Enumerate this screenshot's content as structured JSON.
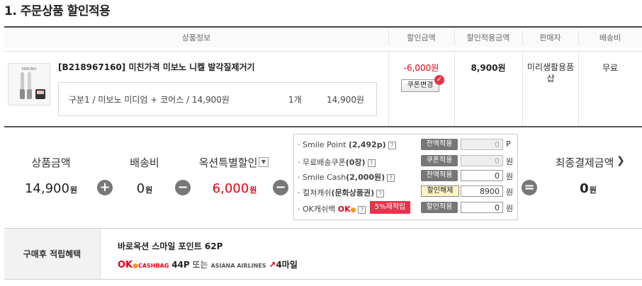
{
  "page_title": "1. 주문상품 할인적용",
  "headers": {
    "product_info": "상품정보",
    "discount_amount": "할인금액",
    "discounted_price": "할인적용금액",
    "seller": "판매자",
    "shipping_fee": "배송비"
  },
  "product": {
    "name": "[B218967160] 미친가격 미보노 니켈 발각질제거기",
    "option_text": "구분1 / 미보노 미디엄 + 코어스 / 14,900원",
    "quantity": "1개",
    "option_price": "14,900원",
    "thumb_brand": "MIBONO",
    "discount": "-6,000원",
    "coupon_button": "쿠폰변경",
    "discounted_price": "8,900원",
    "seller": "미리생활용품샵",
    "shipping": "무료"
  },
  "summary": {
    "product_amount_label": "상품금액",
    "product_amount_value": "14,900",
    "shipping_label": "배송비",
    "shipping_value": "0",
    "auction_discount_label": "옥션특별할인",
    "auction_discount_value": "6,000",
    "final_label": "최종결제금액",
    "final_value": "0",
    "won": "원"
  },
  "discounts": [
    {
      "label": "Smile Point",
      "detail": "(2,492p)",
      "button": "전액적용",
      "value": "0",
      "unit": "P",
      "disabled": true
    },
    {
      "label": "무료배송쿠폰",
      "detail": "(0장)",
      "button": "쿠폰적용",
      "value": "0",
      "unit": "원",
      "disabled": true
    },
    {
      "label": "Smile Cash",
      "detail": "(2,000원)",
      "button": "전액적용",
      "value": "0",
      "unit": "원",
      "disabled": false
    },
    {
      "label": "컬쳐캐쉬",
      "detail": "(문화상품권)",
      "button": "할인해제",
      "value": "8900",
      "unit": "원",
      "disabled": false
    },
    {
      "label": "OK캐쉬백",
      "detail": "",
      "button": "할인적용",
      "value": "0",
      "unit": "원",
      "disabled": false
    }
  ],
  "okcashbag_badge": "5%재적립",
  "ok_logo": "OK",
  "benefit": {
    "label": "구매후 적립혜택",
    "line1": "바로옥션 스마일 포인트 62P",
    "ok_brand": "OK",
    "cashbag": "CASHBAG",
    "points": "44P",
    "or_text": "또는",
    "airline": "ASIANA AIRLINES",
    "miles": "4마일"
  },
  "colors": {
    "discount_red": "#e60012",
    "badge_red": "#e7344c",
    "ok_red": "#e60012",
    "ok_orange": "#f7941d"
  }
}
